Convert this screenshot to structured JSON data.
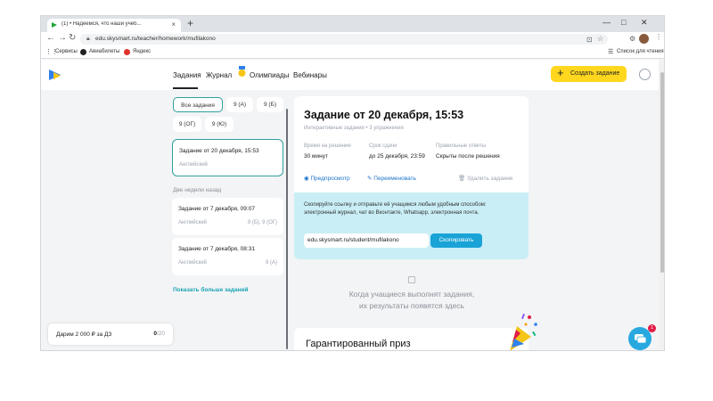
{
  "browser": {
    "tab_title": "(1) • Надеемся, что наши учеб...",
    "url": "edu.skysmart.ru/teacher/homework/mufilakono",
    "new_tab": "+",
    "close_tab": "×",
    "window": {
      "minimize": "—",
      "maximize": "□",
      "close": "✕"
    },
    "nav": {
      "back": "←",
      "forward": "→",
      "reload": "↻"
    },
    "bookmarks": [
      "Сервисы",
      "Авиабилеты",
      "Яндекс"
    ],
    "reading_list": "Список для чтения"
  },
  "header": {
    "nav": [
      "Задания",
      "Журнал",
      "Олимпиады",
      "Вебинары"
    ],
    "create_button": "Создать задание",
    "create_plus": "+"
  },
  "filters": {
    "chips": [
      "Все задания",
      "9 (А)",
      "9 (Б)",
      "9 (ОГ)",
      "9 (Ю)"
    ]
  },
  "assignments": {
    "current": {
      "title": "Задание от 20 декабря, 15:53",
      "subject": "Английский"
    },
    "section_label": "Две недели назад",
    "older": [
      {
        "title": "Задание от 7 декабря, 09:07",
        "subject": "Английский",
        "classes": "9 (Б), 9 (ОГ)"
      },
      {
        "title": "Задание от 7 декабря, 08:31",
        "subject": "Английский",
        "classes": "9 (А)"
      }
    ],
    "show_more": "Показать больше заданий"
  },
  "bonus": {
    "label": "Дарим 2 000 ₽ за ДЗ",
    "count": "0",
    "total": "/20"
  },
  "detail": {
    "title": "Задание от 20 декабря, 15:53",
    "subtitle": "Интерактивные задания • 3 упражнения",
    "info": [
      {
        "label": "Время на решение",
        "value": "30 минут"
      },
      {
        "label": "Срок сдачи",
        "value": "до 25 декабря, 23:59"
      },
      {
        "label": "Правильные ответы",
        "value": "Скрыты после решения"
      }
    ],
    "actions": {
      "preview": "Предпросмотр",
      "rename": "Переименовать",
      "delete": "Удалить задание"
    },
    "share_text": "Скопируйте ссылку и отправьте её учащимся любым удобным способом: электронный журнал, чат во Вконтакте, Whatsapp, электронная почта.",
    "link": "edu.skysmart.ru/student/mufilakono",
    "copy_button": "Скопировать"
  },
  "empty_state": {
    "line1": "Когда учащиеся выполнят задания,",
    "line2": "их результаты появятся здесь"
  },
  "prize": {
    "title": "Гарантированный приз"
  },
  "chat": {
    "badge": "1"
  },
  "colors": {
    "accent_teal": "#2f9e9e",
    "create_yellow": "#ffd71f",
    "share_bg": "#c9eef6",
    "copy_blue": "#1aa3d6",
    "link_blue": "#1a73c8"
  }
}
